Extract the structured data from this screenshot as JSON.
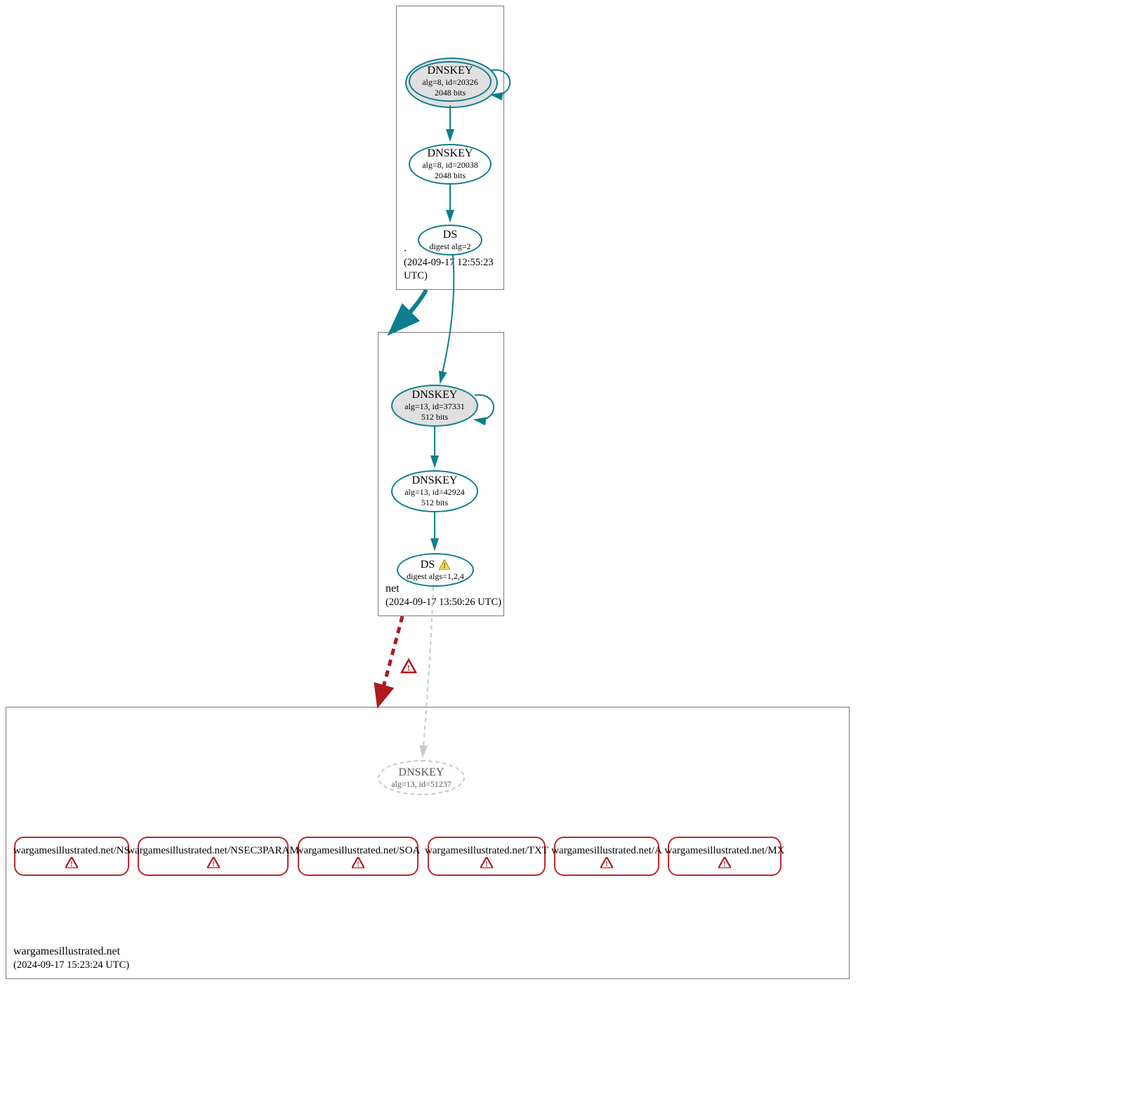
{
  "zones": {
    "root": {
      "name": ".",
      "timestamp": "(2024-09-17 12:55:23 UTC)",
      "nodes": {
        "ksk": {
          "title": "DNSKEY",
          "detail1": "alg=8, id=20326",
          "detail2": "2048 bits"
        },
        "zsk": {
          "title": "DNSKEY",
          "detail1": "alg=8, id=20038",
          "detail2": "2048 bits"
        },
        "ds": {
          "title": "DS",
          "detail1": "digest alg=2"
        }
      }
    },
    "net": {
      "name": "net",
      "timestamp": "(2024-09-17 13:50:26 UTC)",
      "nodes": {
        "ksk": {
          "title": "DNSKEY",
          "detail1": "alg=13, id=37331",
          "detail2": "512 bits"
        },
        "zsk": {
          "title": "DNSKEY",
          "detail1": "alg=13, id=42924",
          "detail2": "512 bits"
        },
        "ds": {
          "title": "DS",
          "detail1": "digest algs=1,2,4"
        }
      }
    },
    "domain": {
      "name": "wargamesillustrated.net",
      "timestamp": "(2024-09-17 15:23:24 UTC)",
      "nodes": {
        "dnskey": {
          "title": "DNSKEY",
          "detail1": "alg=13, id=51237"
        }
      },
      "rrsets": [
        "wargamesillustrated.net/NS",
        "wargamesillustrated.net/NSEC3PARAM",
        "wargamesillustrated.net/SOA",
        "wargamesillustrated.net/TXT",
        "wargamesillustrated.net/A",
        "wargamesillustrated.net/MX"
      ]
    }
  },
  "colors": {
    "teal": "#0d7e8f",
    "red": "#b0191e",
    "gray": "#c8c8c8",
    "box": "#7a7a7a"
  }
}
